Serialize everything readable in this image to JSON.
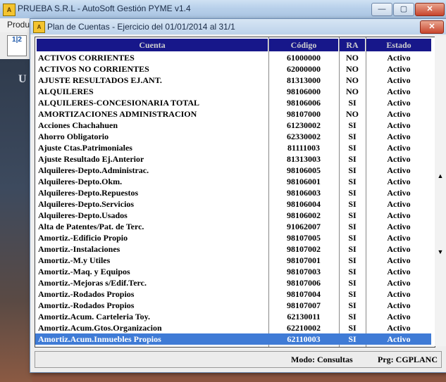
{
  "main_window": {
    "title": "PRUEBA S.R.L - AutoSoft Gestión PYME v1.4",
    "menu_first": "Produ",
    "toolbar_icon_text": "1|2",
    "side_text": "U"
  },
  "dialog": {
    "title": "Plan de Cuentas - Ejercicio del 01/01/2014 al 31/1",
    "columns": [
      "Cuenta",
      "Código",
      "RA",
      "Estado"
    ],
    "rows": [
      {
        "cuenta": "ACTIVOS CORRIENTES",
        "codigo": "61000000",
        "ra": "NO",
        "estado": "Activo"
      },
      {
        "cuenta": "ACTIVOS NO CORRIENTES",
        "codigo": "62000000",
        "ra": "NO",
        "estado": "Activo"
      },
      {
        "cuenta": "AJUSTE RESULTADOS EJ.ANT.",
        "codigo": "81313000",
        "ra": "NO",
        "estado": "Activo"
      },
      {
        "cuenta": "ALQUILERES",
        "codigo": "98106000",
        "ra": "NO",
        "estado": "Activo"
      },
      {
        "cuenta": "ALQUILERES-CONCESIONARIA TOTAL",
        "codigo": "98106006",
        "ra": "SI",
        "estado": "Activo"
      },
      {
        "cuenta": "AMORTIZACIONES ADMINISTRACION",
        "codigo": "98107000",
        "ra": "NO",
        "estado": "Activo"
      },
      {
        "cuenta": "Acciones Chachahuen",
        "codigo": "61230002",
        "ra": "SI",
        "estado": "Activo"
      },
      {
        "cuenta": "Ahorro Obligatorio",
        "codigo": "62330002",
        "ra": "SI",
        "estado": "Activo"
      },
      {
        "cuenta": "Ajuste Ctas.Patrimoniales",
        "codigo": "81111003",
        "ra": "SI",
        "estado": "Activo"
      },
      {
        "cuenta": "Ajuste Resultado Ej.Anterior",
        "codigo": "81313003",
        "ra": "SI",
        "estado": "Activo"
      },
      {
        "cuenta": "Alquileres-Depto.Administrac.",
        "codigo": "98106005",
        "ra": "SI",
        "estado": "Activo"
      },
      {
        "cuenta": "Alquileres-Depto.Okm.",
        "codigo": "98106001",
        "ra": "SI",
        "estado": "Activo"
      },
      {
        "cuenta": "Alquileres-Depto.Repuestos",
        "codigo": "98106003",
        "ra": "SI",
        "estado": "Activo"
      },
      {
        "cuenta": "Alquileres-Depto.Servicios",
        "codigo": "98106004",
        "ra": "SI",
        "estado": "Activo"
      },
      {
        "cuenta": "Alquileres-Depto.Usados",
        "codigo": "98106002",
        "ra": "SI",
        "estado": "Activo"
      },
      {
        "cuenta": "Alta de Patentes/Pat. de Terc.",
        "codigo": "91062007",
        "ra": "SI",
        "estado": "Activo"
      },
      {
        "cuenta": "Amortiz.-Edificio Propio",
        "codigo": "98107005",
        "ra": "SI",
        "estado": "Activo"
      },
      {
        "cuenta": "Amortiz.-Instalaciones",
        "codigo": "98107002",
        "ra": "SI",
        "estado": "Activo"
      },
      {
        "cuenta": "Amortiz.-M.y Utiles",
        "codigo": "98107001",
        "ra": "SI",
        "estado": "Activo"
      },
      {
        "cuenta": "Amortiz.-Maq. y Equipos",
        "codigo": "98107003",
        "ra": "SI",
        "estado": "Activo"
      },
      {
        "cuenta": "Amortiz.-Mejoras s/Edif.Terc.",
        "codigo": "98107006",
        "ra": "SI",
        "estado": "Activo"
      },
      {
        "cuenta": "Amortiz.-Rodados Propios",
        "codigo": "98107004",
        "ra": "SI",
        "estado": "Activo"
      },
      {
        "cuenta": "Amortiz.-Rodados Propios",
        "codigo": "98107007",
        "ra": "SI",
        "estado": "Activo"
      },
      {
        "cuenta": "Amortiz.Acum. Carteleria Toy.",
        "codigo": "62130011",
        "ra": "SI",
        "estado": "Activo"
      },
      {
        "cuenta": "Amortiz.Acum.Gtos.Organizacion",
        "codigo": "62210002",
        "ra": "SI",
        "estado": "Activo"
      },
      {
        "cuenta": "Amortiz.Acum.Inmuebles Propios",
        "codigo": "62110003",
        "ra": "SI",
        "estado": "Activo",
        "selected": true
      }
    ],
    "status": {
      "modo": "Modo: Consultas",
      "prg": "Prg: CGPLANC"
    }
  },
  "colors": {
    "header_bg": "#17178a",
    "selected_row": "#3f7bd6"
  }
}
